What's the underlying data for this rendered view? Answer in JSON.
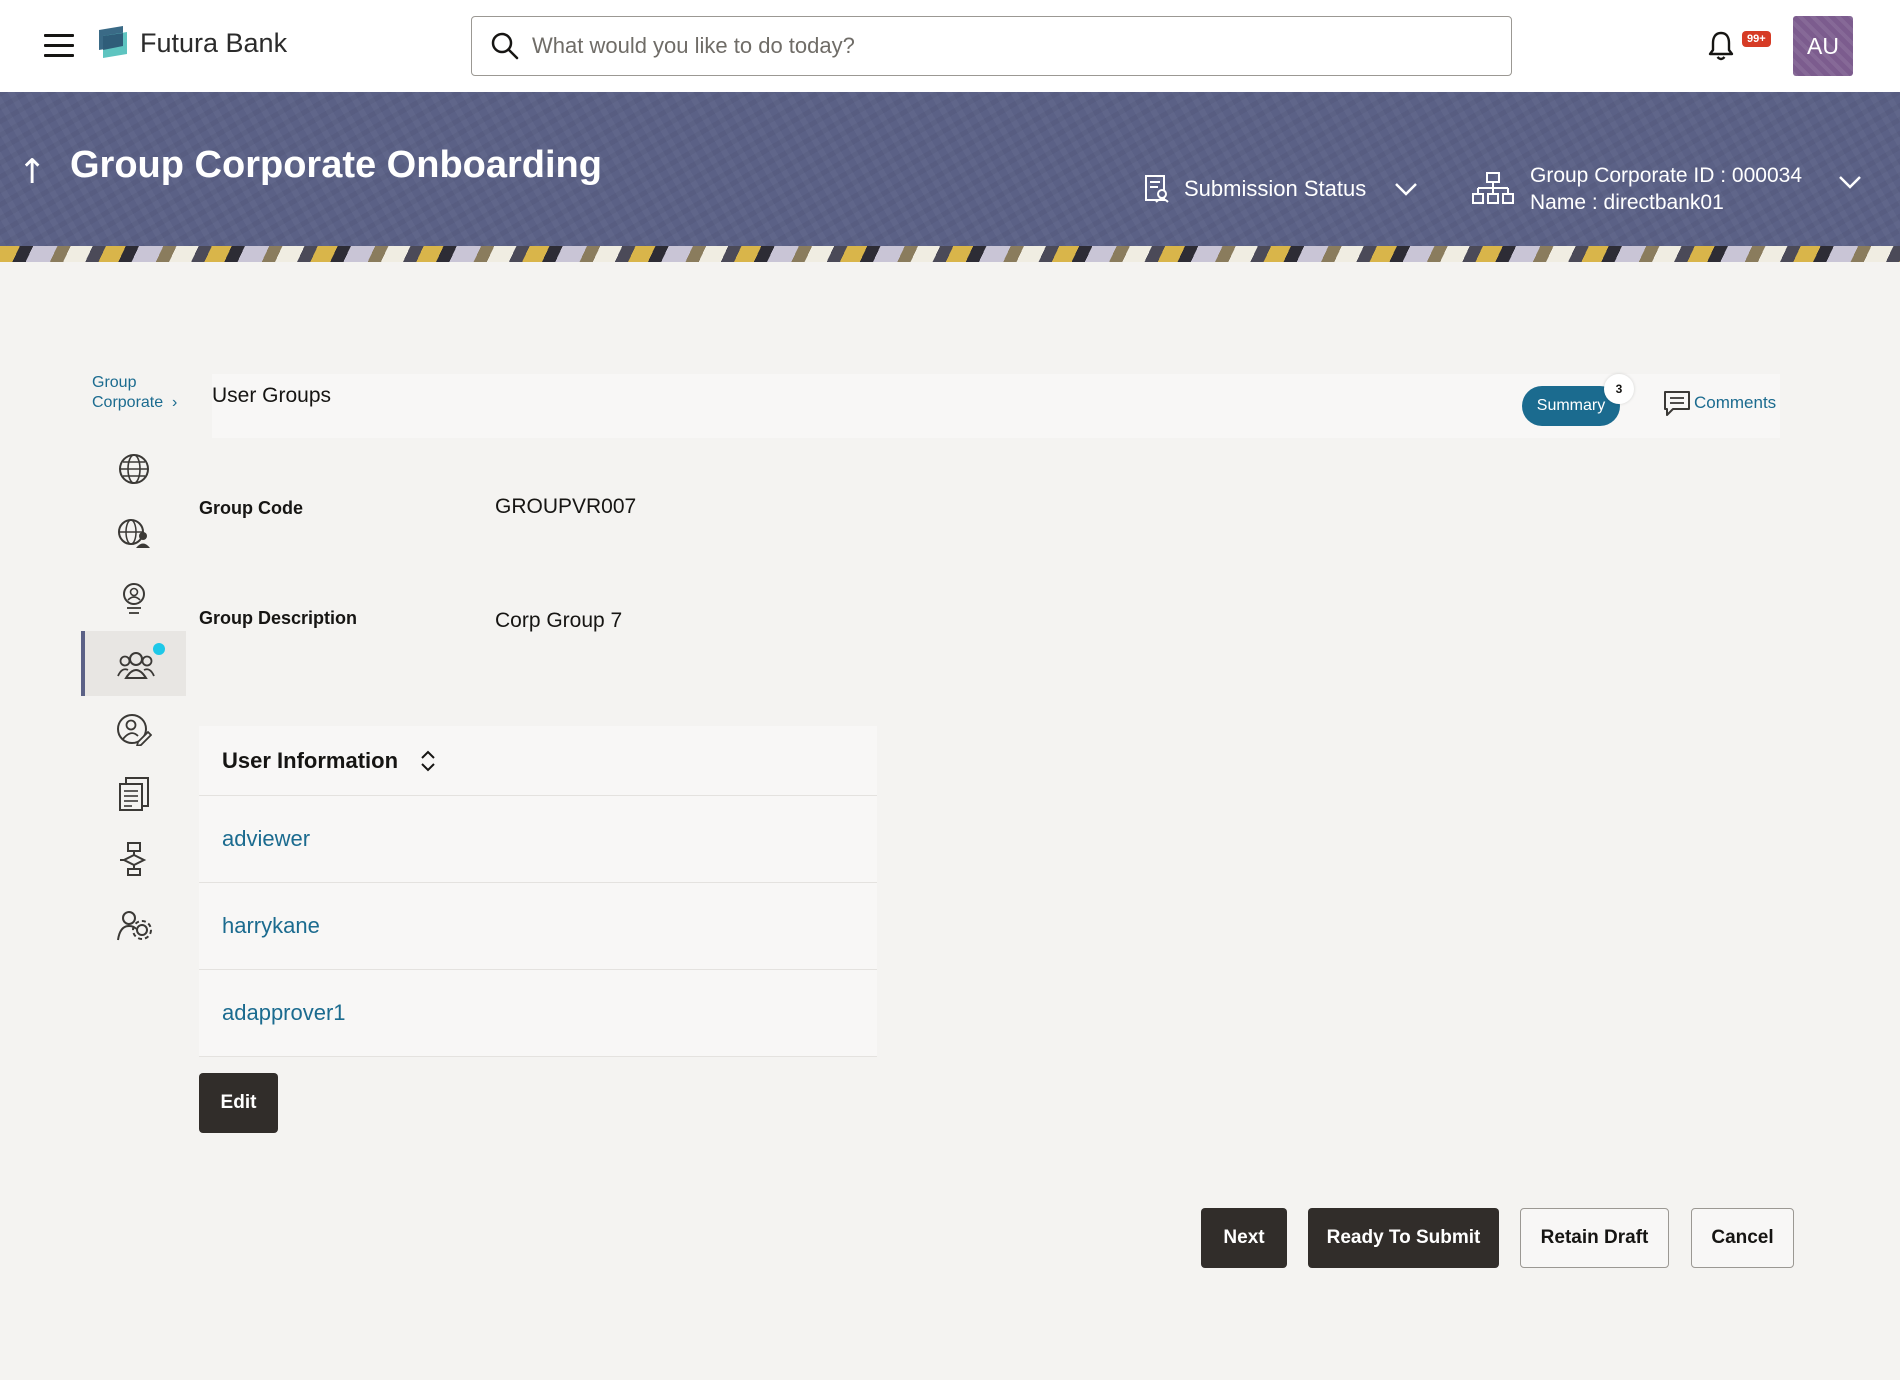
{
  "header": {
    "brand": "Futura Bank",
    "search_placeholder": "What would you like to do today?",
    "notification_count": "99+",
    "avatar_initials": "AU"
  },
  "banner": {
    "title": "Group Corporate Onboarding",
    "submission_status": "Submission Status",
    "group_corporate_id": "Group Corporate ID : 000034",
    "name": "Name : directbank01"
  },
  "breadcrumb": {
    "line1": "Group",
    "line2": "Corporate"
  },
  "section": {
    "title": "User Groups",
    "summary_label": "Summary",
    "summary_count": "3",
    "comments_label": "Comments"
  },
  "fields": {
    "group_code_label": "Group Code",
    "group_code_value": "GROUPVR007",
    "group_description_label": "Group Description",
    "group_description_value": "Corp Group 7"
  },
  "user_table": {
    "header": "User Information",
    "users": [
      "adviewer",
      "harrykane",
      "adapprover1"
    ]
  },
  "buttons": {
    "edit": "Edit",
    "next": "Next",
    "ready_to_submit": "Ready To Submit",
    "retain_draft": "Retain Draft",
    "cancel": "Cancel"
  },
  "colors": {
    "banner": "#5b6186",
    "link": "#1b6b8f",
    "primary_button": "#312d2a",
    "badge": "#d63b25",
    "active_dot": "#1ec8e8"
  }
}
